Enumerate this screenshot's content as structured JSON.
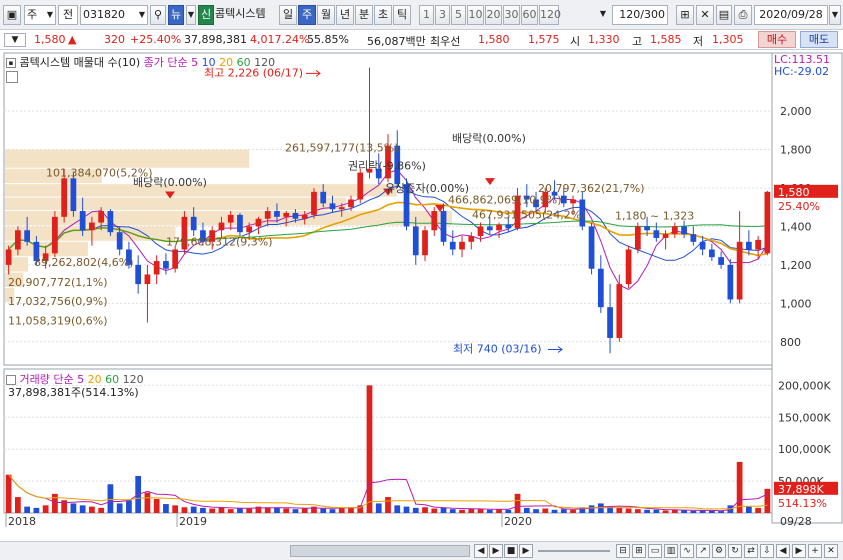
{
  "toolbar": {
    "market": "주",
    "type": "전",
    "code": "031820",
    "news_label": "뉴",
    "credit_label": "신",
    "stock_name": "콤텍시스템",
    "periods": [
      "일",
      "주",
      "월",
      "년",
      "분",
      "초",
      "틱"
    ],
    "selected_period": "주",
    "intervals": [
      "1",
      "3",
      "5",
      "10",
      "20",
      "30",
      "60",
      "120"
    ],
    "count": "120",
    "count_total": "/300",
    "date": "2020/09/28"
  },
  "ticker": {
    "price": "1,580",
    "change_arrow": "▲",
    "change": "320",
    "change_pct": "+25.40%",
    "volume": "37,898,381",
    "vol_ratio": "4,017.24%",
    "turnover": "55.85%",
    "amount": "56,087백만",
    "preferred_label": "최우선",
    "ask": "1,580",
    "bid": "1,575",
    "open_label": "시",
    "open": "1,330",
    "high_label": "고",
    "high": "1,585",
    "low_label": "저",
    "low": "1,305",
    "buy_label": "매수",
    "sell_label": "매도"
  },
  "price_panel": {
    "title": "콤텍시스템 매물대 수(10)",
    "ma_label": "종가 단순",
    "ma_periods": [
      "5",
      "10",
      "20",
      "60",
      "120"
    ],
    "lc": "LC:113.51",
    "hc": "HC:-29.02",
    "y_ticks": [
      "2,000",
      "1,800",
      "1,600",
      "1,400",
      "1,200",
      "1,000",
      "800"
    ],
    "current_price": "1,580",
    "current_pct": "25.40%",
    "high_note": "최고 2,226 (06/17)",
    "low_note": "최저 740 (03/16)",
    "annotations": [
      "배당락(0.00%)",
      "배당락(0.00%)",
      "권리락(-9.86%)",
      "유상증자(0.00%)"
    ],
    "volume_profile": [
      "261,597,177(13,5%)",
      "101,384,070(5,2%)",
      "20,797,362(21,7%)",
      "466,862,069(10,9%)",
      "467,931,505(24,2%)",
      "179,608,312(9,3%)",
      "89,262,802(4,6%)",
      "20,907,772(1,1%)",
      "17,032,756(0,9%)",
      "11,058,319(0,6%)",
      "1,180 ~ 1,323"
    ]
  },
  "volume_panel": {
    "title": "거래량",
    "ma_label": "단순",
    "ma_periods": [
      "5",
      "20",
      "60",
      "120"
    ],
    "current": "37,898,381주(514.13%)",
    "y_ticks": [
      "200,000K",
      "150,000K",
      "100,000K",
      "50,000K"
    ],
    "current_value": "37,898K",
    "current_pct": "514.13%"
  },
  "x_axis": {
    "labels": [
      "2018",
      "2019",
      "2020"
    ],
    "last_date": "09/28"
  },
  "colors": {
    "up": "#e0201b",
    "down": "#1f4fd6",
    "ma5": "#b51cb5",
    "ma10": "#1f4fd6",
    "ma20": "#e8a100",
    "ma60": "#27a23f",
    "ma120": "#555555",
    "profile": "#f4e2c6"
  },
  "chart_data": {
    "type": "candlestick",
    "interval": "weekly",
    "ylim": [
      700,
      2250
    ],
    "candles": [
      [
        1200,
        1300,
        1150,
        1280
      ],
      [
        1280,
        1400,
        1250,
        1380
      ],
      [
        1380,
        1450,
        1300,
        1320
      ],
      [
        1320,
        1350,
        1200,
        1220
      ],
      [
        1220,
        1300,
        1180,
        1260
      ],
      [
        1260,
        1480,
        1240,
        1450
      ],
      [
        1450,
        1700,
        1420,
        1650
      ],
      [
        1650,
        1680,
        1450,
        1480
      ],
      [
        1480,
        1550,
        1350,
        1380
      ],
      [
        1380,
        1450,
        1300,
        1420
      ],
      [
        1420,
        1500,
        1380,
        1480
      ],
      [
        1480,
        1490,
        1350,
        1370
      ],
      [
        1370,
        1400,
        1250,
        1280
      ],
      [
        1280,
        1320,
        1180,
        1200
      ],
      [
        1200,
        1250,
        1050,
        1100
      ],
      [
        1100,
        1200,
        900,
        1150
      ],
      [
        1150,
        1250,
        1100,
        1220
      ],
      [
        1220,
        1260,
        1150,
        1180
      ],
      [
        1180,
        1300,
        1160,
        1280
      ],
      [
        1280,
        1480,
        1260,
        1450
      ],
      [
        1450,
        1500,
        1350,
        1380
      ],
      [
        1380,
        1420,
        1300,
        1320
      ],
      [
        1320,
        1400,
        1280,
        1380
      ],
      [
        1380,
        1450,
        1340,
        1420
      ],
      [
        1420,
        1480,
        1380,
        1460
      ],
      [
        1460,
        1470,
        1350,
        1370
      ],
      [
        1370,
        1420,
        1330,
        1400
      ],
      [
        1400,
        1450,
        1360,
        1440
      ],
      [
        1440,
        1500,
        1400,
        1480
      ],
      [
        1480,
        1520,
        1420,
        1450
      ],
      [
        1450,
        1480,
        1400,
        1470
      ],
      [
        1470,
        1490,
        1420,
        1440
      ],
      [
        1440,
        1480,
        1410,
        1460
      ],
      [
        1460,
        1600,
        1440,
        1580
      ],
      [
        1580,
        1620,
        1500,
        1520
      ],
      [
        1520,
        1560,
        1470,
        1490
      ],
      [
        1490,
        1520,
        1450,
        1500
      ],
      [
        1500,
        1560,
        1480,
        1540
      ],
      [
        1540,
        1700,
        1520,
        1680
      ],
      [
        1680,
        2226,
        1650,
        1700
      ],
      [
        1700,
        1780,
        1620,
        1650
      ],
      [
        1650,
        1880,
        1630,
        1820
      ],
      [
        1820,
        1900,
        1600,
        1620
      ],
      [
        1620,
        1650,
        1380,
        1400
      ],
      [
        1400,
        1450,
        1200,
        1250
      ],
      [
        1250,
        1400,
        1220,
        1380
      ],
      [
        1380,
        1500,
        1350,
        1480
      ],
      [
        1480,
        1520,
        1300,
        1320
      ],
      [
        1320,
        1380,
        1250,
        1280
      ],
      [
        1280,
        1350,
        1240,
        1320
      ],
      [
        1320,
        1370,
        1280,
        1350
      ],
      [
        1350,
        1420,
        1320,
        1400
      ],
      [
        1400,
        1450,
        1360,
        1380
      ],
      [
        1380,
        1420,
        1340,
        1410
      ],
      [
        1410,
        1450,
        1370,
        1390
      ],
      [
        1390,
        1600,
        1380,
        1560
      ],
      [
        1560,
        1620,
        1500,
        1540
      ],
      [
        1540,
        1580,
        1480,
        1500
      ],
      [
        1500,
        1600,
        1470,
        1580
      ],
      [
        1580,
        1640,
        1540,
        1560
      ],
      [
        1560,
        1600,
        1500,
        1520
      ],
      [
        1520,
        1560,
        1460,
        1540
      ],
      [
        1540,
        1580,
        1380,
        1400
      ],
      [
        1400,
        1420,
        1150,
        1180
      ],
      [
        1180,
        1250,
        950,
        980
      ],
      [
        980,
        1100,
        740,
        820
      ],
      [
        820,
        1150,
        800,
        1100
      ],
      [
        1100,
        1300,
        1080,
        1280
      ],
      [
        1280,
        1420,
        1260,
        1400
      ],
      [
        1400,
        1450,
        1350,
        1380
      ],
      [
        1380,
        1420,
        1320,
        1340
      ],
      [
        1340,
        1380,
        1280,
        1360
      ],
      [
        1360,
        1420,
        1340,
        1400
      ],
      [
        1400,
        1430,
        1340,
        1360
      ],
      [
        1360,
        1400,
        1300,
        1320
      ],
      [
        1320,
        1350,
        1250,
        1280
      ],
      [
        1280,
        1310,
        1220,
        1240
      ],
      [
        1240,
        1270,
        1180,
        1200
      ],
      [
        1200,
        1230,
        1000,
        1020
      ],
      [
        1020,
        1480,
        1000,
        1320
      ],
      [
        1320,
        1380,
        1250,
        1280
      ],
      [
        1280,
        1350,
        1230,
        1330
      ],
      [
        1260,
        1585,
        1250,
        1580
      ]
    ],
    "volume_k": [
      60000,
      25000,
      10000,
      8000,
      12000,
      30000,
      20000,
      15000,
      12000,
      10000,
      8000,
      45000,
      15000,
      20000,
      58000,
      32000,
      22000,
      14000,
      12000,
      9000,
      10000,
      8000,
      7000,
      9000,
      6000,
      8000,
      7000,
      10000,
      9000,
      8000,
      7000,
      6000,
      8000,
      10000,
      7000,
      6000,
      8000,
      9000,
      12000,
      200000,
      15000,
      25000,
      12000,
      10000,
      8000,
      9000,
      7000,
      8000,
      6000,
      5000,
      7000,
      6000,
      5000,
      6000,
      5000,
      30000,
      8000,
      6000,
      7000,
      5000,
      6000,
      5000,
      9000,
      12000,
      15000,
      10000,
      8000,
      7000,
      6000,
      5000,
      5000,
      4000,
      5000,
      4000,
      3500,
      4000,
      3500,
      3000,
      12000,
      80000,
      10000,
      8000,
      37898
    ]
  }
}
